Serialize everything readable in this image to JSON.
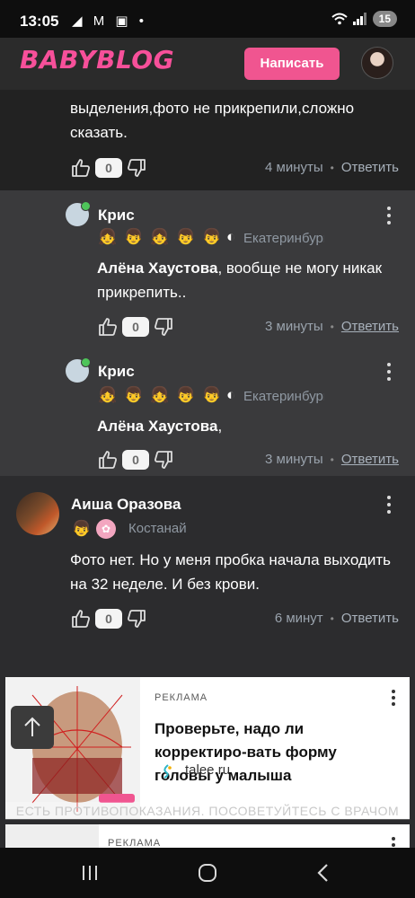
{
  "status_bar": {
    "time": "13:05",
    "left_icons": "◢ M ▣ •",
    "battery": "15"
  },
  "header": {
    "logo": "BABYBLOG",
    "write_button": "Написать"
  },
  "comment_top": {
    "text": "выделения,фото не прикрепили,сложно сказать.",
    "likes": "0",
    "time": "4 минуты",
    "reply": "Ответить"
  },
  "reply1": {
    "name": "Крис",
    "city": "Екатеринбург",
    "mention": "Алёна Хаустова",
    "text": ", вообще не могу никак прикрепить..",
    "likes": "0",
    "time": "3 минуты",
    "reply": "Ответить"
  },
  "reply2": {
    "name": "Крис",
    "city": "Екатеринбург",
    "mention": "Алёна Хаустова",
    "text": ",",
    "likes": "0",
    "time": "3 минуты",
    "reply": "Ответить"
  },
  "comment_aisha": {
    "name": "Аиша Оразова",
    "city": "Костанай",
    "text": "Фото нет. Но у меня пробка начала выходить на 32 неделе. И без крови.",
    "likes": "0",
    "time": "6 минут",
    "reply": "Ответить"
  },
  "ad": {
    "label": "РЕКЛАМА",
    "title": "Проверьте, надо ли корректиро-вать форму головы у малыша",
    "link": "talee.ru",
    "disclaimer": "ЕСТЬ ПРОТИВОПОКАЗАНИЯ. ПОСОВЕТУЙТЕСЬ С ВРАЧОМ"
  },
  "ad2": {
    "label": "РЕКЛАМА"
  },
  "colors": {
    "brand": "#f05590",
    "link_gray": "#a8b1bb",
    "background": "#2c2c2e"
  }
}
